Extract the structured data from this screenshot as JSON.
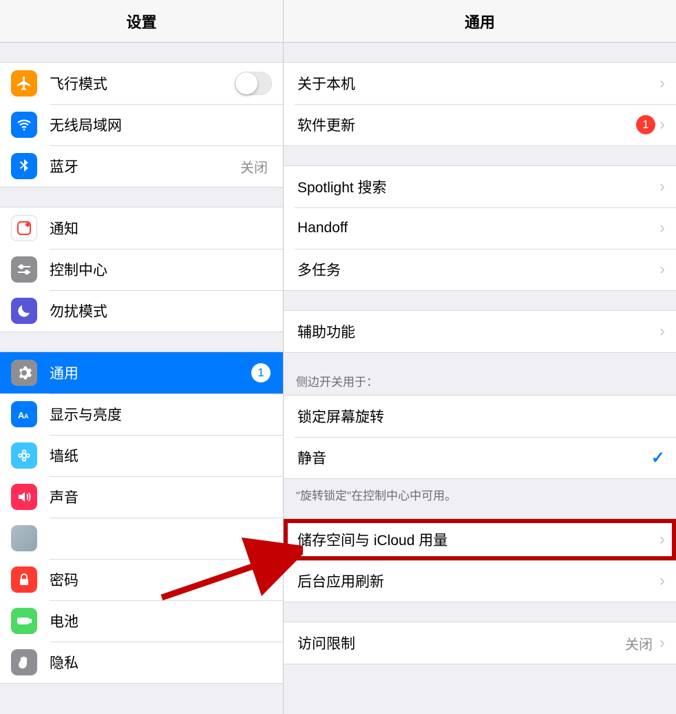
{
  "left": {
    "title": "设置",
    "group1": [
      {
        "key": "airplane",
        "label": "飞行模式",
        "type": "switch",
        "icon": "airplane",
        "bg": "#ff9500"
      },
      {
        "key": "wifi",
        "label": "无线局域网",
        "type": "value",
        "value": "",
        "icon": "wifi",
        "bg": "#007aff"
      },
      {
        "key": "bluetooth",
        "label": "蓝牙",
        "type": "value",
        "value": "关闭",
        "icon": "bluetooth",
        "bg": "#007aff"
      }
    ],
    "group2": [
      {
        "key": "notifications",
        "label": "通知",
        "icon": "notification",
        "bg": "#ffffff",
        "border": true,
        "color": "#ff3b30"
      },
      {
        "key": "controlcenter",
        "label": "控制中心",
        "icon": "control",
        "bg": "#8e8e93"
      },
      {
        "key": "dnd",
        "label": "勿扰模式",
        "icon": "moon",
        "bg": "#5856d6"
      }
    ],
    "group3": [
      {
        "key": "general",
        "label": "通用",
        "icon": "gear",
        "bg": "#8e8e93",
        "selected": true,
        "badge": "1"
      },
      {
        "key": "display",
        "label": "显示与亮度",
        "icon": "display",
        "bg": "#007aff"
      },
      {
        "key": "wallpaper",
        "label": "墙纸",
        "icon": "wallpaper",
        "bg": "#40c4ff"
      },
      {
        "key": "sound",
        "label": "声音",
        "icon": "sound",
        "bg": "#ff2d55"
      },
      {
        "key": "siri",
        "label": "",
        "icon": "siri",
        "bg": "#cfd8dc",
        "blur": true
      },
      {
        "key": "passwords",
        "label": "密码",
        "icon": "lock",
        "bg": "#ff3b30"
      },
      {
        "key": "battery",
        "label": "电池",
        "icon": "battery",
        "bg": "#4cd964"
      },
      {
        "key": "privacy",
        "label": "隐私",
        "icon": "hand",
        "bg": "#8e8e93"
      }
    ]
  },
  "right": {
    "title": "通用",
    "group1": [
      {
        "key": "about",
        "label": "关于本机"
      },
      {
        "key": "update",
        "label": "软件更新",
        "badge": "1"
      }
    ],
    "group2": [
      {
        "key": "spotlight",
        "label": "Spotlight 搜索"
      },
      {
        "key": "handoff",
        "label": "Handoff"
      },
      {
        "key": "multitask",
        "label": "多任务"
      }
    ],
    "group3": [
      {
        "key": "accessibility",
        "label": "辅助功能"
      }
    ],
    "sideHeader": "侧边开关用于：",
    "group4": [
      {
        "key": "lockrotate",
        "label": "锁定屏幕旋转"
      },
      {
        "key": "mute",
        "label": "静音",
        "checked": true
      }
    ],
    "sideFooter": "\"旋转锁定\"在控制中心中可用。",
    "group5": [
      {
        "key": "storage",
        "label": "储存空间与 iCloud 用量",
        "highlight": true
      },
      {
        "key": "bgrefresh",
        "label": "后台应用刷新"
      }
    ],
    "group6": [
      {
        "key": "restrict",
        "label": "访问限制",
        "value": "关闭"
      }
    ]
  }
}
